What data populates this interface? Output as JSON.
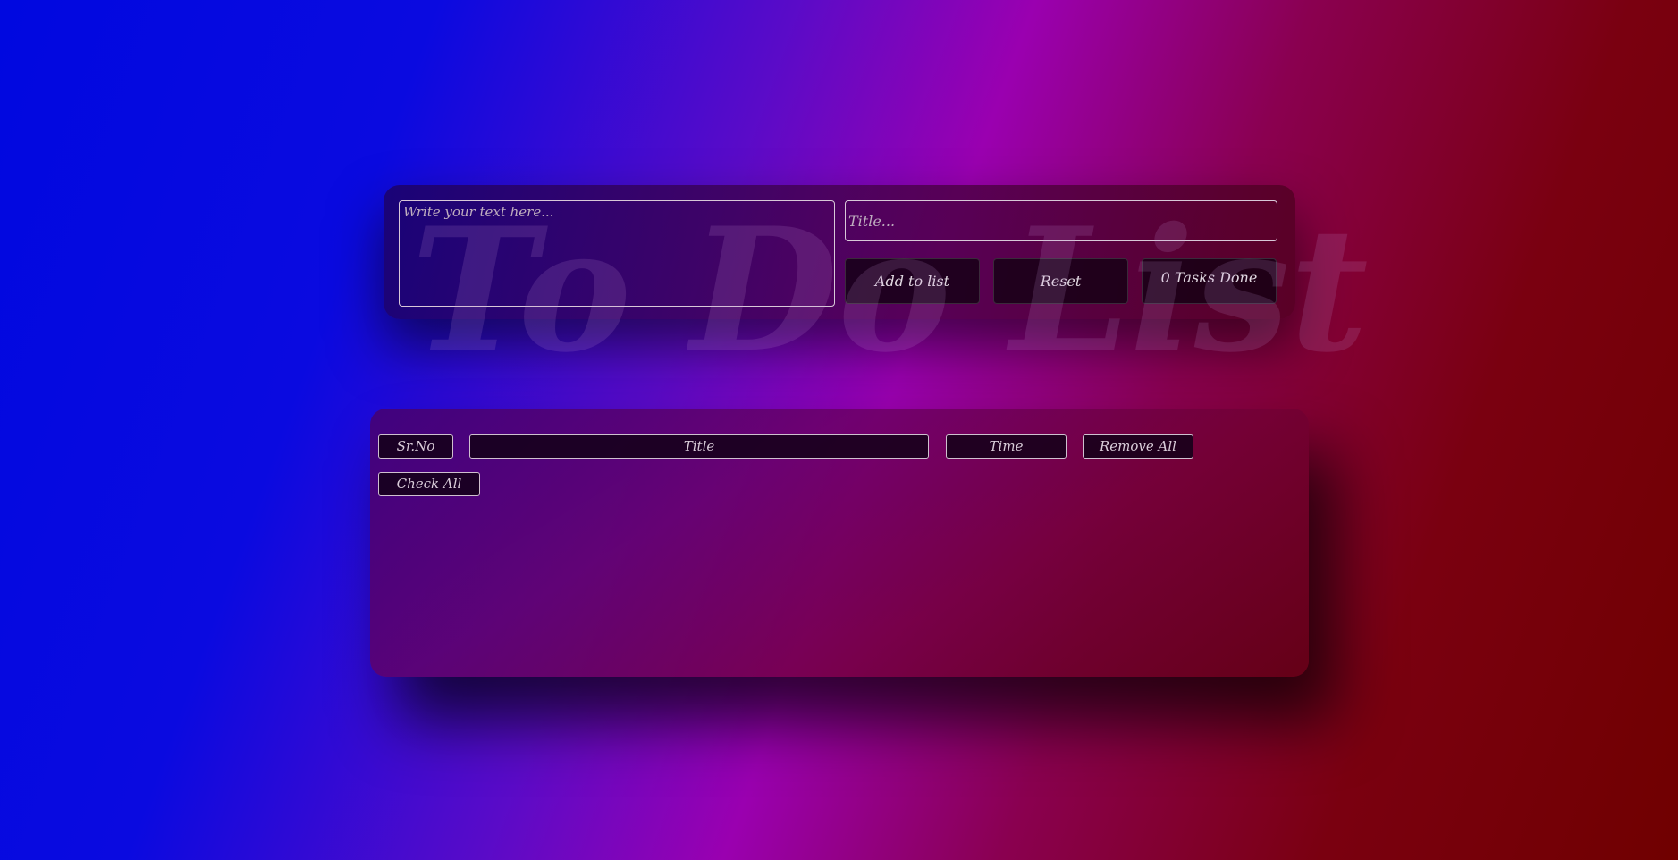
{
  "watermark": {
    "text": "To Do List"
  },
  "form": {
    "text_placeholder": "Write your text here...",
    "text_value": "",
    "title_placeholder": "Title...",
    "title_value": ""
  },
  "actions": {
    "add_label": "Add to list",
    "reset_label": "Reset",
    "tasks_done_label": "0 Tasks Done"
  },
  "list": {
    "headers": {
      "srno": "Sr.No",
      "title": "Title",
      "time": "Time",
      "remove_all": "Remove All",
      "check_all": "Check All"
    },
    "items": []
  },
  "colors": {
    "background_left": "#0008e0",
    "background_mid": "#9a00b0",
    "background_right": "#700000",
    "button_bg": "#140014",
    "text": "#e0d6e0"
  }
}
